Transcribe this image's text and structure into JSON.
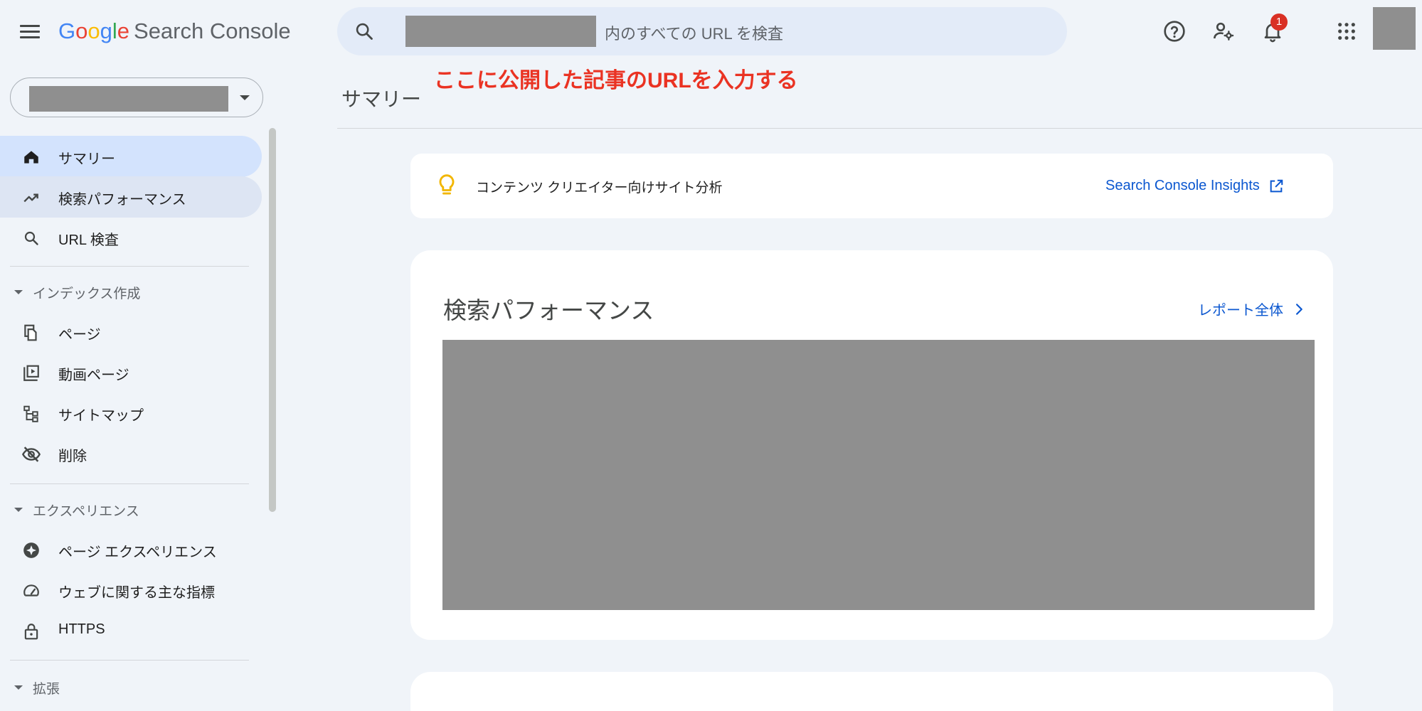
{
  "header": {
    "logo": {
      "g1": "G",
      "o1": "o",
      "o2": "o",
      "g2": "g",
      "l": "l",
      "e": "e",
      "product": "Search Console"
    },
    "search_placeholder": "内のすべての URL を検査",
    "notification_count": "1"
  },
  "annotation": "ここに公開した記事のURLを入力する",
  "sidebar": {
    "items": [
      {
        "label": "サマリー",
        "icon": "home-icon",
        "state": "active"
      },
      {
        "label": "検索パフォーマンス",
        "icon": "trending-up-icon",
        "state": "hover"
      },
      {
        "label": "URL 検査",
        "icon": "search-icon",
        "state": ""
      }
    ],
    "sections": [
      {
        "label": "インデックス作成",
        "items": [
          {
            "label": "ページ",
            "icon": "pages-icon"
          },
          {
            "label": "動画ページ",
            "icon": "video-pages-icon"
          },
          {
            "label": "サイトマップ",
            "icon": "sitemap-icon"
          },
          {
            "label": "削除",
            "icon": "visibility-off-icon"
          }
        ]
      },
      {
        "label": "エクスペリエンス",
        "items": [
          {
            "label": "ページ エクスペリエンス",
            "icon": "experience-icon"
          },
          {
            "label": "ウェブに関する主な指標",
            "icon": "speed-gauge-icon"
          },
          {
            "label": "HTTPS",
            "icon": "lock-icon"
          }
        ]
      },
      {
        "label": "拡張",
        "items": []
      }
    ]
  },
  "main": {
    "title": "サマリー",
    "insight": {
      "text": "コンテンツ クリエイター向けサイト分析",
      "link_label": "Search Console Insights"
    },
    "performance": {
      "title": "検索パフォーマンス",
      "link_label": "レポート全体"
    }
  },
  "colors": {
    "background": "#f0f4f9",
    "accent_blue": "#0b57d0",
    "active_nav": "#d3e3fd",
    "annotation_red": "#ea3323",
    "badge_red": "#d93025"
  }
}
